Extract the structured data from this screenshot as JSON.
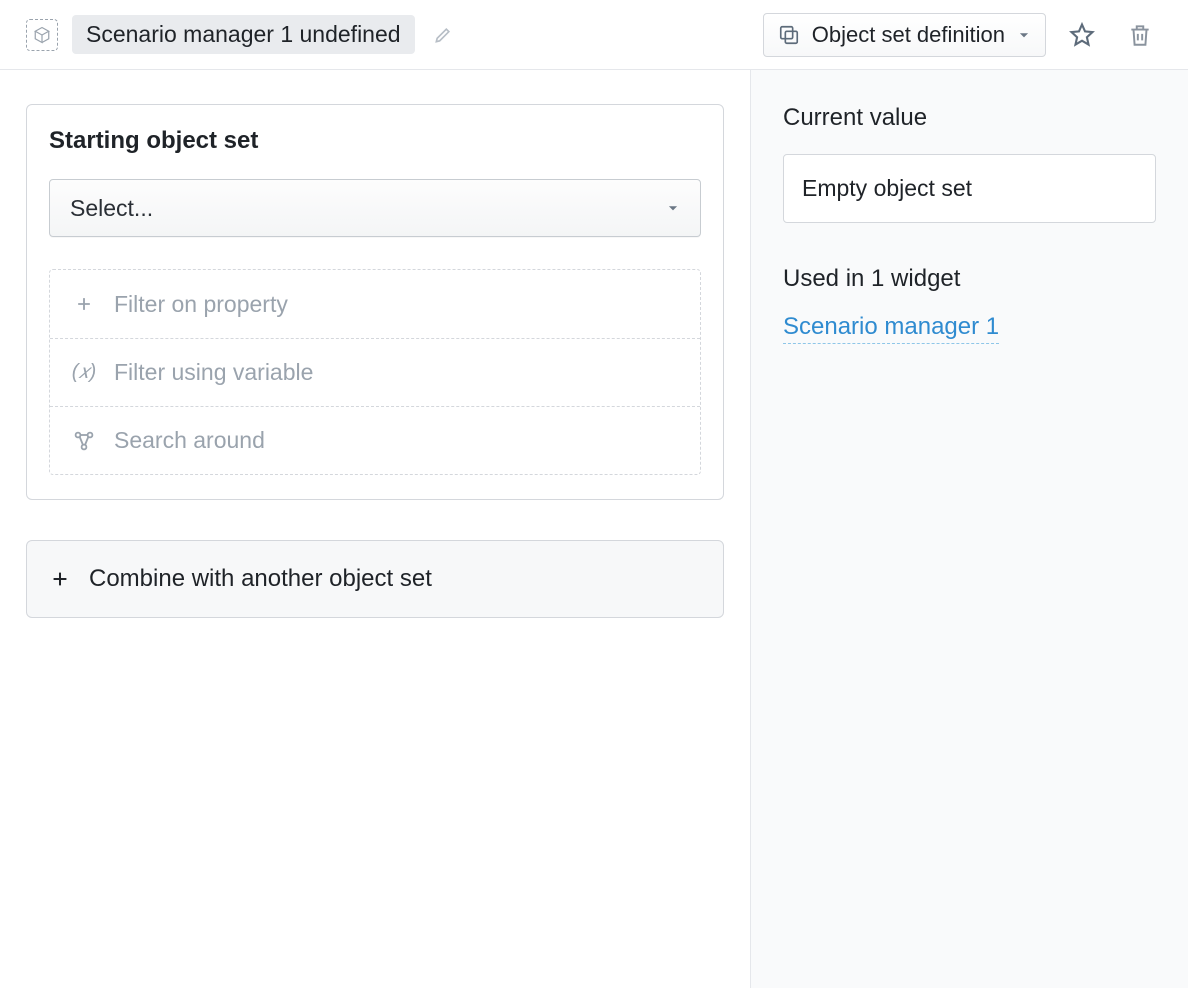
{
  "header": {
    "title_chip": "Scenario manager 1 undefined",
    "type_dropdown": "Object set definition"
  },
  "main": {
    "card_title": "Starting object set",
    "select_placeholder": "Select...",
    "filters": {
      "property": "Filter on property",
      "variable": "Filter using variable",
      "search_around": "Search around"
    },
    "combine_label": "Combine with another object set"
  },
  "side": {
    "current_value_label": "Current value",
    "current_value": "Empty object set",
    "used_in_label": "Used in 1 widget",
    "widget_link": "Scenario manager 1"
  }
}
